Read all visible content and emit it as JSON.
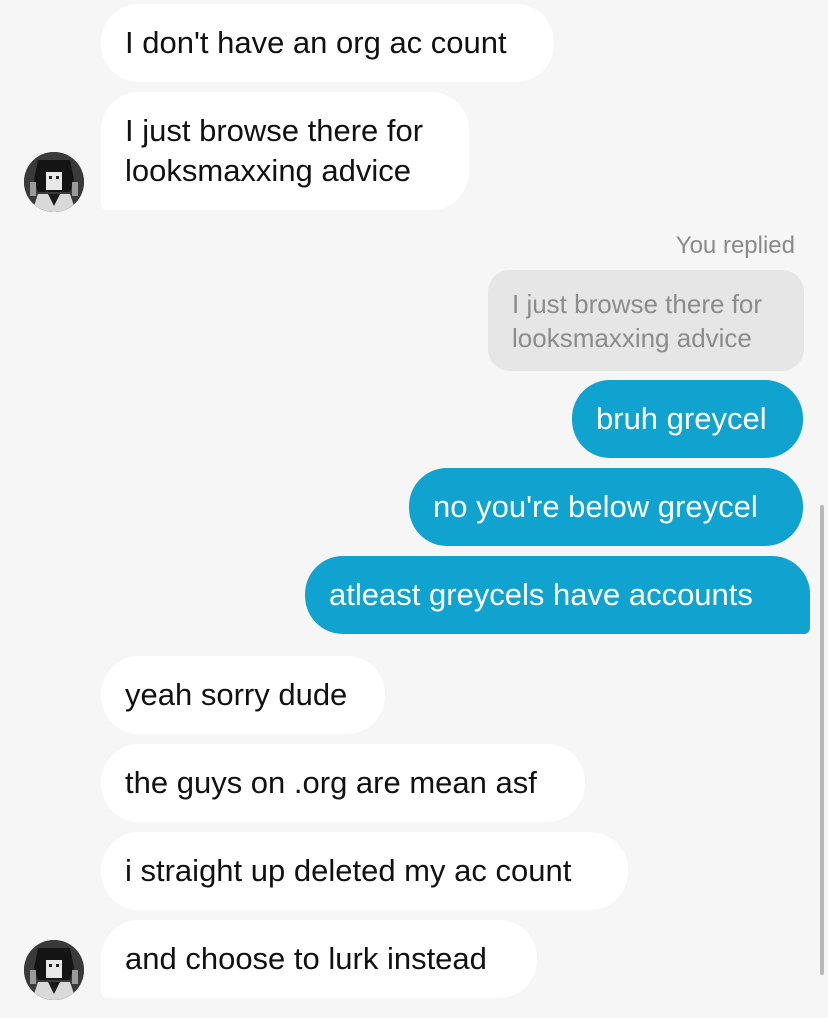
{
  "conversation": {
    "incoming_top": [
      {
        "lines": [
          "I don't have an org ac count"
        ]
      },
      {
        "lines": [
          "I just browse there for",
          "looksmaxxing advice"
        ]
      }
    ],
    "reply_context": {
      "label": "You replied",
      "quoted_lines": [
        "I just browse there for",
        "looksmaxxing advice"
      ]
    },
    "outgoing": [
      {
        "text": "bruh greycel"
      },
      {
        "text": "no you're below greycel"
      },
      {
        "text": "atleast greycels have accounts"
      }
    ],
    "incoming_bottom": [
      {
        "text": "yeah sorry dude"
      },
      {
        "text": "the guys on .org are mean asf"
      },
      {
        "text": "i straight up deleted my ac count"
      },
      {
        "text": "and choose to lurk instead"
      }
    ]
  },
  "colors": {
    "outgoing_bubble": "#10a3cf",
    "incoming_bubble": "#ffffff",
    "background": "#f6f6f6"
  },
  "icons": {
    "avatar": "user-avatar-icon"
  }
}
